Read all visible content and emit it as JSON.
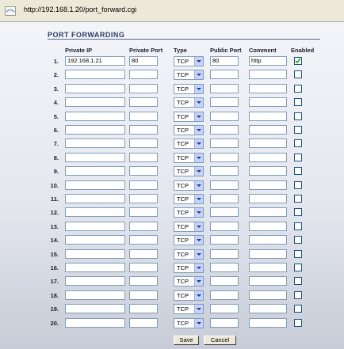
{
  "browser": {
    "url": "http://192.168.1.20/port_forward.cgi"
  },
  "section_title": "PORT FORWARDING",
  "columns": {
    "private_ip": "Private IP",
    "private_port": "Private Port",
    "type": "Type",
    "public_port": "Public Port",
    "comment": "Comment",
    "enabled": "Enabled"
  },
  "rows": [
    {
      "num": "1.",
      "private_ip": "192.168.1.21",
      "private_port": "80",
      "type": "TCP",
      "public_port": "80",
      "comment": "http",
      "enabled": true
    },
    {
      "num": "2.",
      "private_ip": "",
      "private_port": "",
      "type": "TCP",
      "public_port": "",
      "comment": "",
      "enabled": false
    },
    {
      "num": "3.",
      "private_ip": "",
      "private_port": "",
      "type": "TCP",
      "public_port": "",
      "comment": "",
      "enabled": false
    },
    {
      "num": "4.",
      "private_ip": "",
      "private_port": "",
      "type": "TCP",
      "public_port": "",
      "comment": "",
      "enabled": false
    },
    {
      "num": "5.",
      "private_ip": "",
      "private_port": "",
      "type": "TCP",
      "public_port": "",
      "comment": "",
      "enabled": false
    },
    {
      "num": "6.",
      "private_ip": "",
      "private_port": "",
      "type": "TCP",
      "public_port": "",
      "comment": "",
      "enabled": false
    },
    {
      "num": "7.",
      "private_ip": "",
      "private_port": "",
      "type": "TCP",
      "public_port": "",
      "comment": "",
      "enabled": false
    },
    {
      "num": "8.",
      "private_ip": "",
      "private_port": "",
      "type": "TCP",
      "public_port": "",
      "comment": "",
      "enabled": false
    },
    {
      "num": "9.",
      "private_ip": "",
      "private_port": "",
      "type": "TCP",
      "public_port": "",
      "comment": "",
      "enabled": false
    },
    {
      "num": "10.",
      "private_ip": "",
      "private_port": "",
      "type": "TCP",
      "public_port": "",
      "comment": "",
      "enabled": false
    },
    {
      "num": "11.",
      "private_ip": "",
      "private_port": "",
      "type": "TCP",
      "public_port": "",
      "comment": "",
      "enabled": false
    },
    {
      "num": "12.",
      "private_ip": "",
      "private_port": "",
      "type": "TCP",
      "public_port": "",
      "comment": "",
      "enabled": false
    },
    {
      "num": "13.",
      "private_ip": "",
      "private_port": "",
      "type": "TCP",
      "public_port": "",
      "comment": "",
      "enabled": false
    },
    {
      "num": "14.",
      "private_ip": "",
      "private_port": "",
      "type": "TCP",
      "public_port": "",
      "comment": "",
      "enabled": false
    },
    {
      "num": "15.",
      "private_ip": "",
      "private_port": "",
      "type": "TCP",
      "public_port": "",
      "comment": "",
      "enabled": false
    },
    {
      "num": "16.",
      "private_ip": "",
      "private_port": "",
      "type": "TCP",
      "public_port": "",
      "comment": "",
      "enabled": false
    },
    {
      "num": "17.",
      "private_ip": "",
      "private_port": "",
      "type": "TCP",
      "public_port": "",
      "comment": "",
      "enabled": false
    },
    {
      "num": "18.",
      "private_ip": "",
      "private_port": "",
      "type": "TCP",
      "public_port": "",
      "comment": "",
      "enabled": false
    },
    {
      "num": "19.",
      "private_ip": "",
      "private_port": "",
      "type": "TCP",
      "public_port": "",
      "comment": "",
      "enabled": false
    },
    {
      "num": "20.",
      "private_ip": "",
      "private_port": "",
      "type": "TCP",
      "public_port": "",
      "comment": "",
      "enabled": false
    }
  ],
  "buttons": {
    "save": "Save",
    "cancel": "Cancel"
  },
  "icons": {
    "page": "page-icon",
    "dropdown": "chevron-down-icon",
    "check": "check-icon"
  }
}
